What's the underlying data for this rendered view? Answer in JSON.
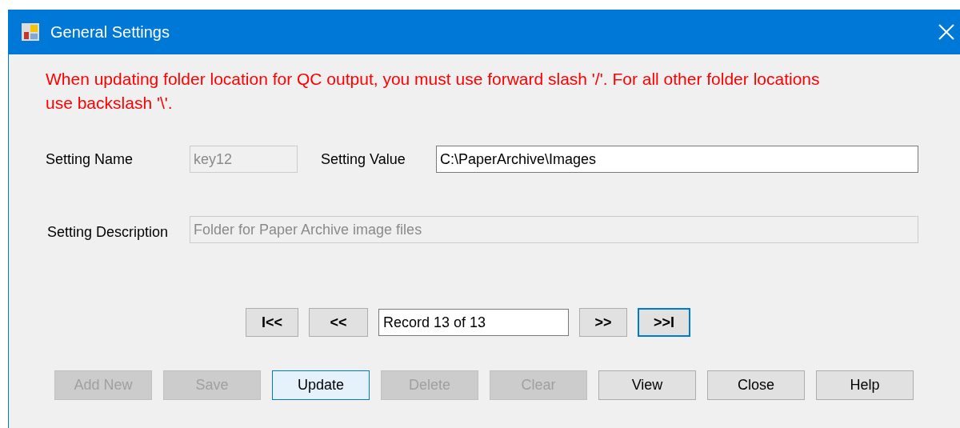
{
  "window": {
    "title": "General Settings"
  },
  "warning": "When updating folder location for QC output, you must use forward slash '/'. For all other folder locations use backslash '\\'.",
  "setting_name": {
    "label": "Setting Name",
    "value": "key12",
    "disabled": true
  },
  "setting_value": {
    "label": "Setting Value",
    "value": "C:\\PaperArchive\\Images",
    "disabled": false
  },
  "setting_description": {
    "label": "Setting Description",
    "value": "Folder for Paper Archive image files",
    "disabled": true
  },
  "navigation": {
    "first": {
      "label": "I<<",
      "focused": false
    },
    "previous": {
      "label": "<<",
      "focused": false
    },
    "record": "Record 13 of 13",
    "next": {
      "label": ">>",
      "focused": false
    },
    "last": {
      "label": ">>I",
      "focused": true
    }
  },
  "actions": [
    {
      "label": "Add New",
      "disabled": true,
      "default": false
    },
    {
      "label": "Save",
      "disabled": true,
      "default": false
    },
    {
      "label": "Update",
      "disabled": false,
      "default": true
    },
    {
      "label": "Delete",
      "disabled": true,
      "default": false
    },
    {
      "label": "Clear",
      "disabled": true,
      "default": false
    },
    {
      "label": "View",
      "disabled": false,
      "default": false
    },
    {
      "label": "Close",
      "disabled": false,
      "default": false
    },
    {
      "label": "Help",
      "disabled": false,
      "default": false
    }
  ]
}
